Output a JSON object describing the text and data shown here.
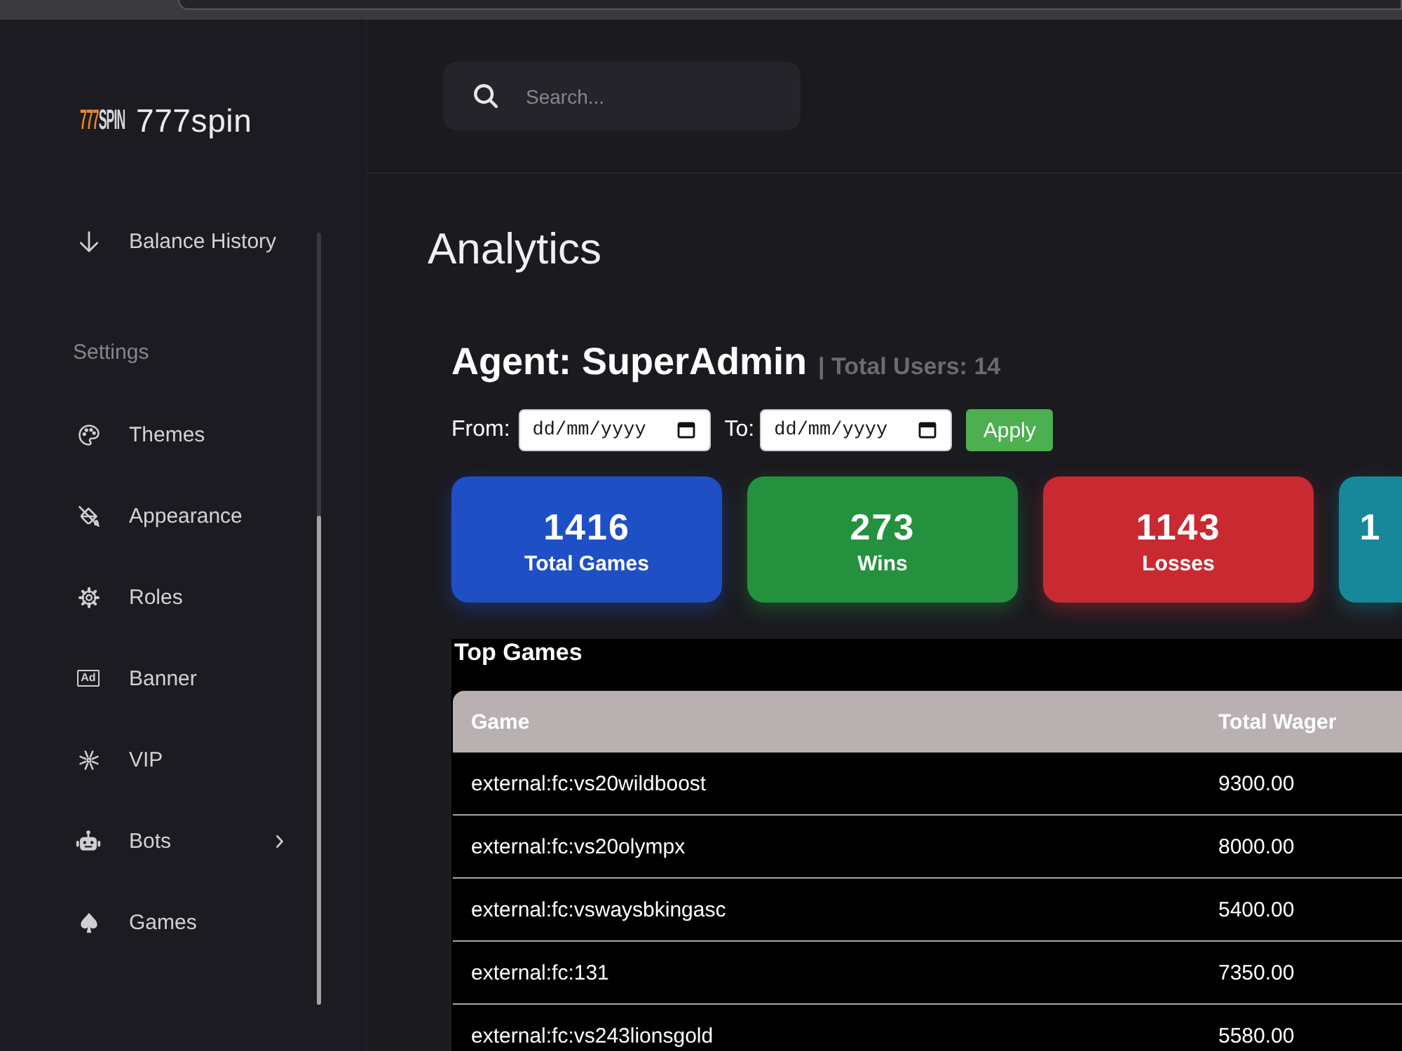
{
  "sidebar": {
    "logo": {
      "mark_number": "777",
      "mark_word": "SPIN",
      "name": "777spin"
    },
    "items": [
      {
        "label": "Balance History",
        "kind": "link"
      }
    ],
    "sections": [
      {
        "title": "Settings",
        "items": [
          {
            "label": "Themes",
            "kind": "link"
          },
          {
            "label": "Appearance",
            "kind": "link"
          },
          {
            "label": "Roles",
            "kind": "link"
          },
          {
            "label": "Banner",
            "kind": "link",
            "icon_text": "Ad"
          },
          {
            "label": "VIP",
            "kind": "link"
          },
          {
            "label": "Bots",
            "kind": "submenu"
          },
          {
            "label": "Games",
            "kind": "link"
          }
        ]
      }
    ]
  },
  "search": {
    "placeholder": "Search..."
  },
  "page_title": "Analytics",
  "agent": {
    "heading": "Agent: SuperAdmin",
    "total_users": "| Total Users: 14"
  },
  "date_filter": {
    "from_label": "From:",
    "from": {
      "placeholder": "dd/mm/yyyy"
    },
    "to_label": "To:",
    "to": {
      "placeholder": "dd/mm/yyyy"
    },
    "apply": "Apply"
  },
  "stats": [
    {
      "value": "1416",
      "label": "Total Games",
      "color": "#1f4fc5"
    },
    {
      "value": "273",
      "label": "Wins",
      "color": "#24913e"
    },
    {
      "value": "1143",
      "label": "Losses",
      "color": "#c92a32"
    },
    {
      "value": "1",
      "color": "#16889a"
    }
  ],
  "top_games": {
    "title": "Top Games",
    "columns": [
      "Game",
      "Total Wager"
    ],
    "rows": [
      [
        "external:fc:vs20wildboost",
        "9300.00"
      ],
      [
        "external:fc:vs20olympx",
        "8000.00"
      ],
      [
        "external:fc:vswaysbkingasc",
        "5400.00"
      ],
      [
        "external:fc:131",
        "7350.00"
      ],
      [
        "external:fc:vs243lionsgold",
        "5580.00"
      ]
    ]
  }
}
